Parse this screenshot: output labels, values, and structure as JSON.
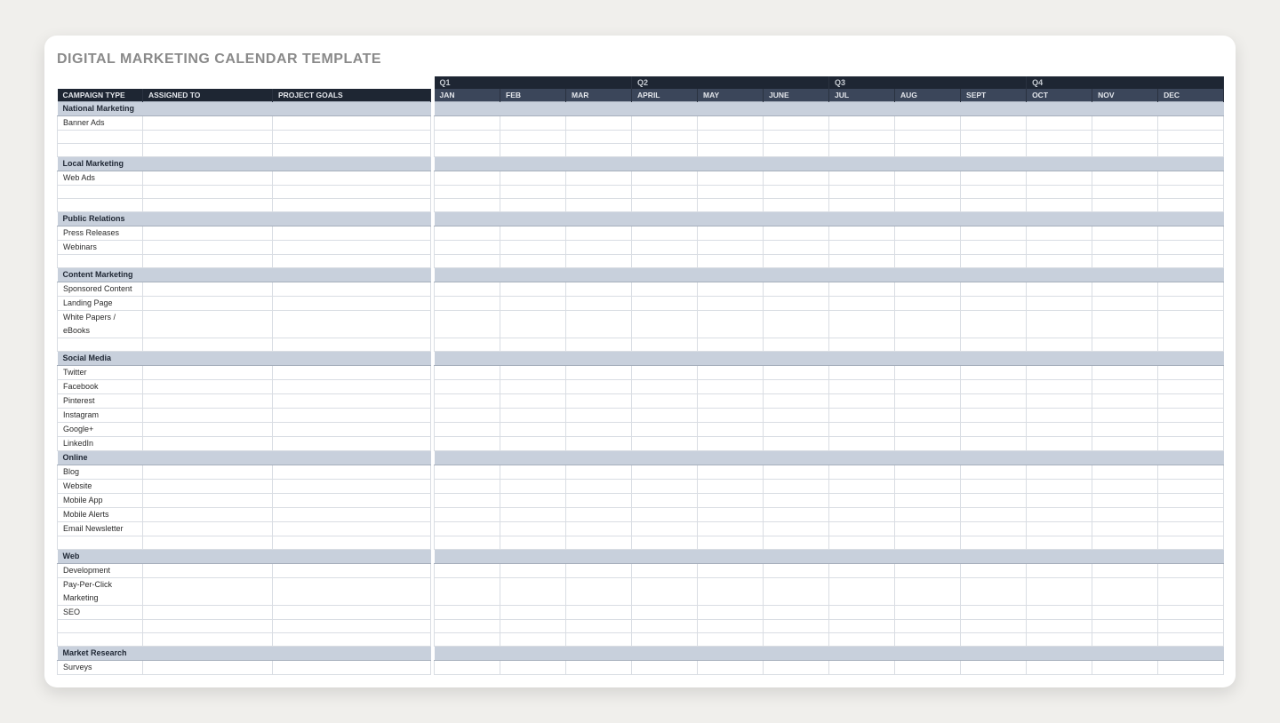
{
  "title": "DIGITAL MARKETING CALENDAR TEMPLATE",
  "quarters": [
    "Q1",
    "Q2",
    "Q3",
    "Q4"
  ],
  "months": [
    "JAN",
    "FEB",
    "MAR",
    "APRIL",
    "MAY",
    "JUNE",
    "JUL",
    "AUG",
    "SEPT",
    "OCT",
    "NOV",
    "DEC"
  ],
  "headers": {
    "campaign_type": "CAMPAIGN TYPE",
    "assigned_to": "ASSIGNED TO",
    "project_goals": "PROJECT GOALS"
  },
  "sections": [
    {
      "name": "National Marketing",
      "items": [
        "Banner Ads",
        "",
        ""
      ]
    },
    {
      "name": "Local Marketing",
      "items": [
        "Web Ads",
        "",
        ""
      ]
    },
    {
      "name": "Public Relations",
      "items": [
        "Press Releases",
        "Webinars",
        ""
      ]
    },
    {
      "name": "Content Marketing",
      "items": [
        "Sponsored Content",
        "Landing Page",
        "White Papers / eBooks",
        ""
      ]
    },
    {
      "name": "Social Media",
      "items": [
        "Twitter",
        "Facebook",
        "Pinterest",
        "Instagram",
        "Google+",
        "LinkedIn"
      ]
    },
    {
      "name": "Online",
      "items": [
        "Blog",
        "Website",
        "Mobile App",
        "Mobile Alerts",
        "Email Newsletter",
        ""
      ]
    },
    {
      "name": "Web",
      "items": [
        "Development",
        "Pay-Per-Click Marketing",
        "SEO",
        "",
        ""
      ]
    },
    {
      "name": "Market Research",
      "items": [
        "Surveys"
      ]
    }
  ]
}
